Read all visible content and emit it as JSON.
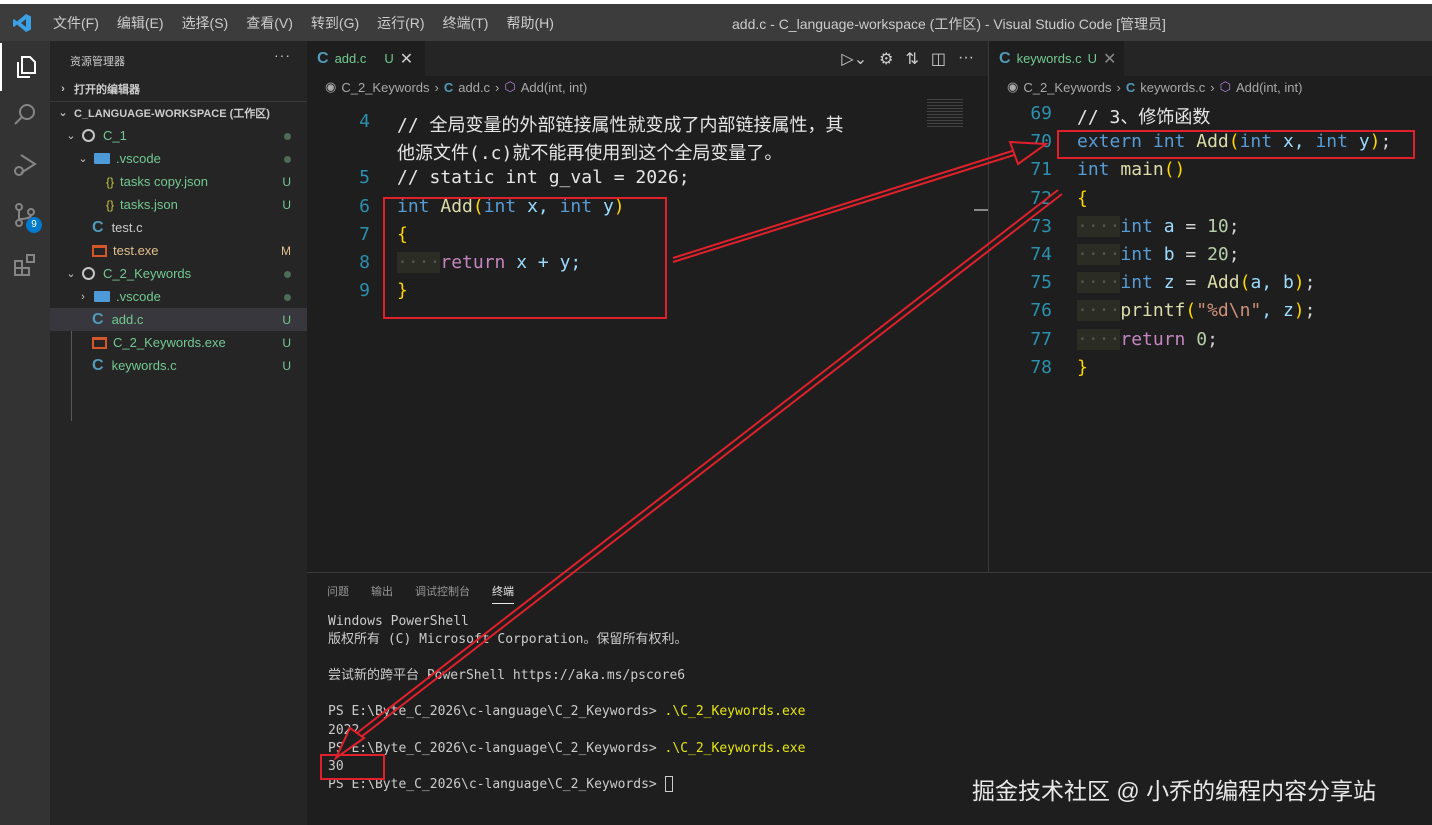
{
  "titlebar": {
    "menu": [
      "文件(F)",
      "编辑(E)",
      "选择(S)",
      "查看(V)",
      "转到(G)",
      "运行(R)",
      "终端(T)",
      "帮助(H)"
    ],
    "title": "add.c - C_language-workspace (工作区) - Visual Studio Code [管理员]"
  },
  "activity": {
    "scm_badge": "9"
  },
  "sidebar": {
    "header": "资源管理器",
    "more": "···",
    "open_editors": "打开的编辑器",
    "workspace": "C_LANGUAGE-WORKSPACE (工作区)",
    "items": [
      {
        "label": "C_1",
        "status": "",
        "kind": "folder-root",
        "depth": 1,
        "open": true,
        "color": "green",
        "dot": true
      },
      {
        "label": ".vscode",
        "status": "",
        "kind": "vscode-folder",
        "depth": 2,
        "open": true,
        "color": "green",
        "dot": true
      },
      {
        "label": "tasks copy.json",
        "status": "U",
        "kind": "json",
        "depth": 3,
        "color": "green"
      },
      {
        "label": "tasks.json",
        "status": "U",
        "kind": "json",
        "depth": 3,
        "color": "green"
      },
      {
        "label": "test.c",
        "status": "",
        "kind": "c",
        "depth": 2,
        "color": "plain"
      },
      {
        "label": "test.exe",
        "status": "M",
        "kind": "exe",
        "depth": 2,
        "color": "mod"
      },
      {
        "label": "C_2_Keywords",
        "status": "",
        "kind": "folder-root",
        "depth": 1,
        "open": true,
        "color": "green",
        "dot": true
      },
      {
        "label": ".vscode",
        "status": "",
        "kind": "vscode-folder",
        "depth": 2,
        "open": false,
        "color": "green",
        "dot": true
      },
      {
        "label": "add.c",
        "status": "U",
        "kind": "c",
        "depth": 2,
        "color": "green",
        "selected": true
      },
      {
        "label": "C_2_Keywords.exe",
        "status": "U",
        "kind": "exe",
        "depth": 2,
        "color": "green"
      },
      {
        "label": "keywords.c",
        "status": "U",
        "kind": "c",
        "depth": 2,
        "color": "green"
      }
    ]
  },
  "editor_left": {
    "tab": "add.c",
    "tab_status": "U",
    "crumbs": [
      "C_2_Keywords",
      "add.c",
      "Add(int, int)"
    ],
    "lines": [
      {
        "n": "4",
        "t": [
          [
            "// 全局变量的外部链接属性就变成了内部链接属性，其",
            "cm"
          ]
        ]
      },
      {
        "n": "",
        "t": [
          [
            "他源文件(.c)就不能再使用到这个全局变量了。",
            "cm"
          ]
        ]
      },
      {
        "n": "5",
        "t": [
          [
            "// static int g_val = 2026;",
            "cm"
          ]
        ]
      },
      {
        "n": "6",
        "t": [
          [
            "int",
            "kw"
          ],
          [
            " ",
            "pl"
          ],
          [
            "Add",
            "fn"
          ],
          [
            "(",
            "br"
          ],
          [
            "int",
            "kw"
          ],
          [
            " x, ",
            "var"
          ],
          [
            "int",
            "kw"
          ],
          [
            " y",
            "var"
          ],
          [
            ")",
            "br"
          ]
        ]
      },
      {
        "n": "7",
        "t": [
          [
            "{",
            "br"
          ]
        ]
      },
      {
        "n": "8",
        "t": [
          [
            "····",
            "ind"
          ],
          [
            "return",
            "ctl"
          ],
          [
            " x + y;",
            "var"
          ]
        ]
      },
      {
        "n": "9",
        "t": [
          [
            "}",
            "br"
          ]
        ]
      }
    ]
  },
  "editor_right": {
    "tab": "keywords.c",
    "tab_status": "U",
    "crumbs": [
      "C_2_Keywords",
      "keywords.c",
      "Add(int, int)"
    ],
    "lines": [
      {
        "n": "69",
        "t": [
          [
            "// 3、修饰函数",
            "cm"
          ]
        ]
      },
      {
        "n": "70",
        "t": [
          [
            "extern",
            "kw"
          ],
          [
            " ",
            "pl"
          ],
          [
            "int",
            "kw"
          ],
          [
            " ",
            "pl"
          ],
          [
            "Add",
            "fn"
          ],
          [
            "(",
            "br"
          ],
          [
            "int",
            "kw"
          ],
          [
            " x, ",
            "var"
          ],
          [
            "int",
            "kw"
          ],
          [
            " y",
            "var"
          ],
          [
            ")",
            "br"
          ],
          [
            ";",
            "pl"
          ]
        ]
      },
      {
        "n": "71",
        "t": [
          [
            "int",
            "kw"
          ],
          [
            " ",
            "pl"
          ],
          [
            "main",
            "fn"
          ],
          [
            "()",
            "br"
          ]
        ]
      },
      {
        "n": "72",
        "t": [
          [
            "{",
            "br"
          ]
        ]
      },
      {
        "n": "73",
        "t": [
          [
            "····",
            "ind"
          ],
          [
            "int",
            "kw"
          ],
          [
            " a",
            "var"
          ],
          [
            " = ",
            "pl"
          ],
          [
            "10",
            "num"
          ],
          [
            ";",
            "pl"
          ]
        ]
      },
      {
        "n": "74",
        "t": [
          [
            "····",
            "ind"
          ],
          [
            "int",
            "kw"
          ],
          [
            " b",
            "var"
          ],
          [
            " = ",
            "pl"
          ],
          [
            "20",
            "num"
          ],
          [
            ";",
            "pl"
          ]
        ]
      },
      {
        "n": "75",
        "t": [
          [
            "····",
            "ind"
          ],
          [
            "int",
            "kw"
          ],
          [
            " z",
            "var"
          ],
          [
            " = ",
            "pl"
          ],
          [
            "Add",
            "fn"
          ],
          [
            "(",
            "br"
          ],
          [
            "a, b",
            "var"
          ],
          [
            ")",
            "br"
          ],
          [
            ";",
            "pl"
          ]
        ]
      },
      {
        "n": "76",
        "t": [
          [
            "····",
            "ind"
          ],
          [
            "printf",
            "fn"
          ],
          [
            "(",
            "br"
          ],
          [
            "\"%d\\n\"",
            "str"
          ],
          [
            ", z",
            "var"
          ],
          [
            ")",
            "br"
          ],
          [
            ";",
            "pl"
          ]
        ]
      },
      {
        "n": "77",
        "t": [
          [
            "····",
            "ind"
          ],
          [
            "return",
            "ctl"
          ],
          [
            " ",
            "pl"
          ],
          [
            "0",
            "num"
          ],
          [
            ";",
            "pl"
          ]
        ]
      },
      {
        "n": "78",
        "t": [
          [
            "}",
            "br"
          ]
        ]
      }
    ]
  },
  "panel": {
    "tabs": [
      "问题",
      "输出",
      "调试控制台",
      "终端"
    ],
    "active_tab": "终端",
    "terminal": [
      {
        "text": "Windows PowerShell"
      },
      {
        "text": "版权所有 (C) Microsoft Corporation。保留所有权利。"
      },
      {
        "text": ""
      },
      {
        "text": "尝试新的跨平台 PowerShell https://aka.ms/pscore6"
      },
      {
        "text": ""
      },
      {
        "text": "PS E:\\Byte_C_2026\\c-language\\C_2_Keywords> ",
        "cmd": ".\\C_2_Keywords.exe"
      },
      {
        "text": "2022"
      },
      {
        "text": "PS E:\\Byte_C_2026\\c-language\\C_2_Keywords> ",
        "cmd": ".\\C_2_Keywords.exe"
      },
      {
        "text": "30"
      },
      {
        "text": "PS E:\\Byte_C_2026\\c-language\\C_2_Keywords> ",
        "cursor": true
      }
    ]
  },
  "watermark": "掘金技术社区 @ 小乔的编程内容分享站",
  "colors": {
    "annotation": "#e0202a",
    "accent": "#007acc"
  }
}
